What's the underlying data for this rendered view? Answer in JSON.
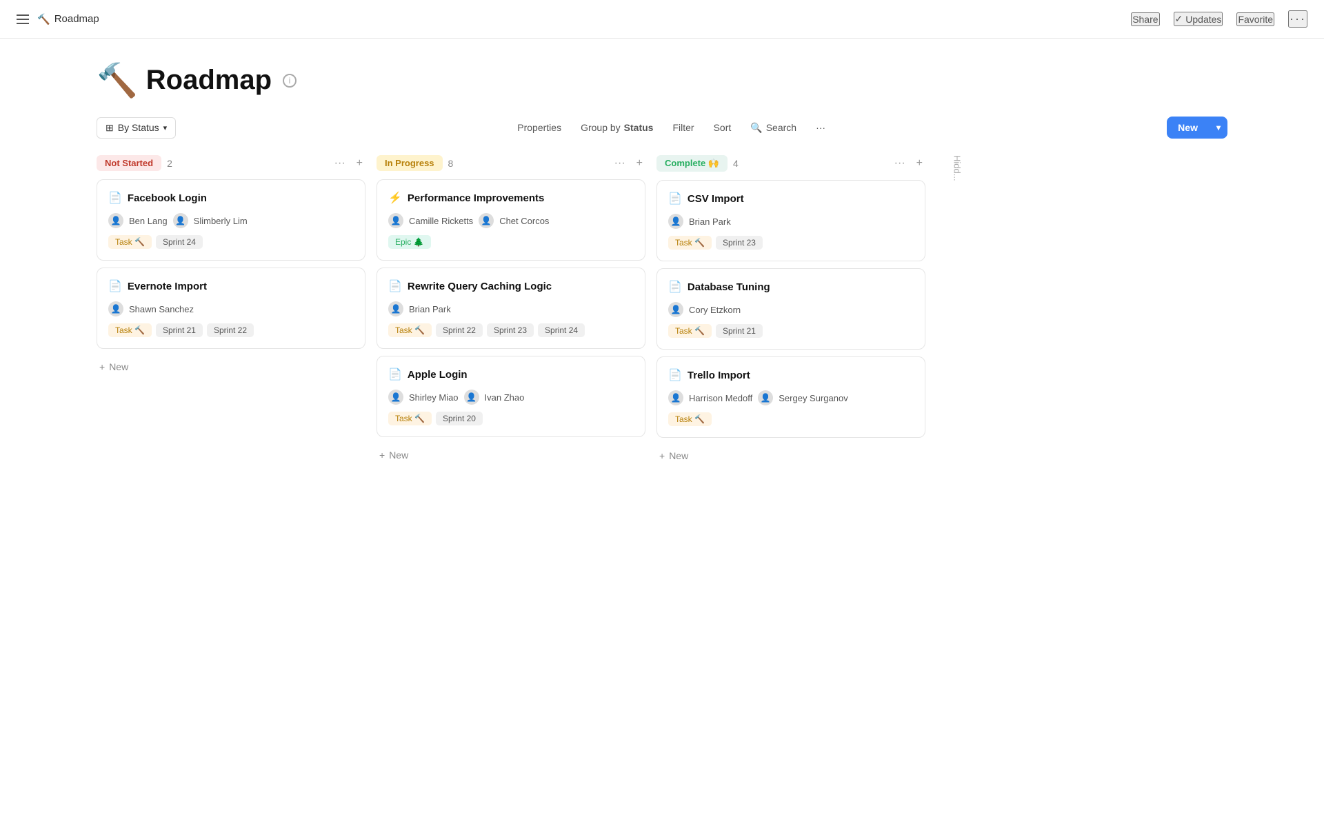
{
  "topbar": {
    "app_icon": "🔨",
    "app_title": "Roadmap",
    "share_label": "Share",
    "updates_label": "Updates",
    "favorite_label": "Favorite",
    "more_label": "···"
  },
  "page": {
    "icon": "🔨",
    "title": "Roadmap",
    "info_icon": "i"
  },
  "toolbar": {
    "by_status_label": "By Status",
    "properties_label": "Properties",
    "group_by_label": "Group by",
    "group_by_bold": "Status",
    "filter_label": "Filter",
    "sort_label": "Sort",
    "search_label": "Search",
    "more_label": "···",
    "new_label": "New"
  },
  "columns": [
    {
      "id": "not-started",
      "status_label": "Not Started",
      "status_class": "status-not-started",
      "count": 2,
      "cards": [
        {
          "title": "Facebook Login",
          "assignees": [
            {
              "name": "Ben Lang",
              "avatar": "👤"
            },
            {
              "name": "Slimberly Lim",
              "avatar": "👤"
            }
          ],
          "tags": [
            "Task 🔨",
            "Sprint 24"
          ]
        },
        {
          "title": "Evernote Import",
          "assignees": [
            {
              "name": "Shawn Sanchez",
              "avatar": "👤"
            }
          ],
          "tags": [
            "Task 🔨",
            "Sprint 21",
            "Sprint 22"
          ]
        }
      ],
      "add_label": "New"
    },
    {
      "id": "in-progress",
      "status_label": "In Progress",
      "status_class": "status-in-progress",
      "count": 8,
      "cards": [
        {
          "title": "Performance Improvements",
          "assignees": [
            {
              "name": "Camille Ricketts",
              "avatar": "👤"
            },
            {
              "name": "Chet Corcos",
              "avatar": "👤"
            }
          ],
          "tags": [
            "Epic 🌲"
          ],
          "title_icon": "⚡"
        },
        {
          "title": "Rewrite Query Caching Logic",
          "assignees": [
            {
              "name": "Brian Park",
              "avatar": "👤"
            }
          ],
          "tags": [
            "Task 🔨",
            "Sprint 22",
            "Sprint 23",
            "Sprint 24"
          ]
        },
        {
          "title": "Apple Login",
          "assignees": [
            {
              "name": "Shirley Miao",
              "avatar": "👤"
            },
            {
              "name": "Ivan Zhao",
              "avatar": "👤"
            }
          ],
          "tags": [
            "Task 🔨",
            "Sprint 20"
          ]
        }
      ],
      "add_label": "New"
    },
    {
      "id": "complete",
      "status_label": "Complete 🙌",
      "status_class": "status-complete",
      "count": 4,
      "cards": [
        {
          "title": "CSV Import",
          "assignees": [
            {
              "name": "Brian Park",
              "avatar": "👤"
            }
          ],
          "tags": [
            "Task 🔨",
            "Sprint 23"
          ]
        },
        {
          "title": "Database Tuning",
          "assignees": [
            {
              "name": "Cory Etzkorn",
              "avatar": "👤"
            }
          ],
          "tags": [
            "Task 🔨",
            "Sprint 21"
          ]
        },
        {
          "title": "Trello Import",
          "assignees": [
            {
              "name": "Harrison Medoff",
              "avatar": "👤"
            },
            {
              "name": "Sergey Surganov",
              "avatar": "👤"
            }
          ],
          "tags": [
            "Task 🔨"
          ]
        }
      ],
      "add_label": "New"
    }
  ],
  "hidden_column": {
    "label": "Hidd..."
  }
}
